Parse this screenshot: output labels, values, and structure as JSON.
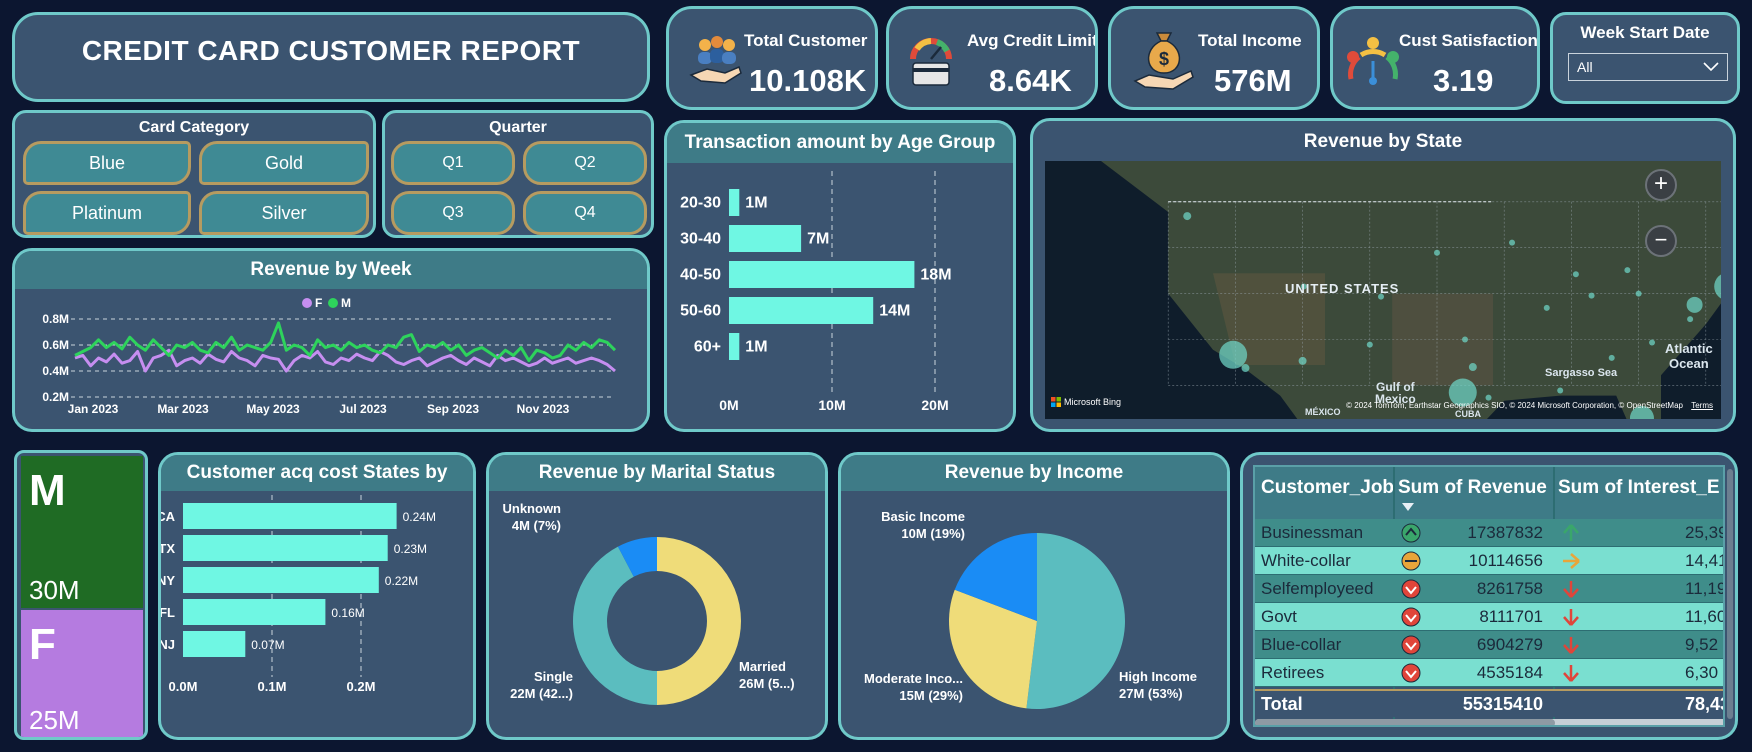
{
  "report_title": "CREDIT CARD CUSTOMER REPORT",
  "kpis": [
    {
      "title": "Total Customer",
      "value": "10.108K",
      "icon": "customers-hand-icon"
    },
    {
      "title": "Avg Credit Limit",
      "value": "8.64K",
      "icon": "credit-gauge-icon"
    },
    {
      "title": "Total Income",
      "value": "576M",
      "icon": "money-bag-hand-icon"
    },
    {
      "title": "Cust Satisfaction..",
      "value": "3.19",
      "icon": "satisfaction-meter-icon"
    }
  ],
  "week_filter": {
    "title": "Week Start Date",
    "selected": "All"
  },
  "card_category": {
    "title": "Card Category",
    "options": [
      "Blue",
      "Gold",
      "Platinum",
      "Silver"
    ]
  },
  "quarter": {
    "title": "Quarter",
    "options": [
      "Q1",
      "Q2",
      "Q3",
      "Q4"
    ]
  },
  "age_chart": {
    "title": "Transaction amount by Age Group"
  },
  "state_map": {
    "title": "Revenue by State",
    "labels": {
      "country": "UNITED STATES",
      "gulf": "Gulf of\nMexico",
      "atlantic": "Atlantic\nOcean",
      "sargasso": "Sargasso Sea",
      "mexico": "MÉXICO",
      "cuba": "CUBA"
    },
    "brand": "Microsoft Bing",
    "copyright": "© 2024 TomTom, Earthstar Geographics SIO, © 2024 Microsoft Corporation, © OpenStreetMap",
    "terms": "Terms",
    "zoom_in": "+",
    "zoom_out": "−"
  },
  "week_chart": {
    "title": "Revenue by Week"
  },
  "gender_tiles": [
    {
      "label": "M",
      "value": "30M",
      "color": "#1f6b24"
    },
    {
      "label": "F",
      "value": "25M",
      "color": "#b57be0"
    }
  ],
  "acq_chart": {
    "title": "Customer acq cost States by"
  },
  "marital_chart": {
    "title": "Revenue by Marital Status"
  },
  "income_chart": {
    "title": "Revenue by Income"
  },
  "job_table": {
    "columns": [
      "Customer_Job",
      "Sum of Revenue",
      "Sum of Interest_E"
    ],
    "rows": [
      {
        "job": "Businessman",
        "revenue": "17387832",
        "interest": "25,39",
        "status": "up",
        "trend": "up"
      },
      {
        "job": "White-collar",
        "revenue": "10114656",
        "interest": "14,41",
        "status": "mid",
        "trend": "right"
      },
      {
        "job": "Selfemployeed",
        "revenue": "8261758",
        "interest": "11,19",
        "status": "down",
        "trend": "down"
      },
      {
        "job": "Govt",
        "revenue": "8111701",
        "interest": "11,60",
        "status": "down",
        "trend": "down"
      },
      {
        "job": "Blue-collar",
        "revenue": "6904279",
        "interest": "9,52",
        "status": "down",
        "trend": "down"
      },
      {
        "job": "Retirees",
        "revenue": "4535184",
        "interest": "6,30",
        "status": "down",
        "trend": "down"
      }
    ],
    "total": {
      "label": "Total",
      "revenue": "55315410",
      "interest": "78,43"
    }
  },
  "chart_data": [
    {
      "type": "bar",
      "orientation": "horizontal",
      "title": "Transaction amount by Age Group",
      "categories": [
        "20-30",
        "30-40",
        "40-50",
        "50-60",
        "60+"
      ],
      "values": [
        1,
        7,
        18,
        14,
        1
      ],
      "data_labels": [
        "1M",
        "7M",
        "18M",
        "14M",
        "1M"
      ],
      "x_ticks": [
        "0M",
        "10M",
        "20M"
      ],
      "xlim": [
        0,
        20
      ],
      "unit": "M",
      "color": "#6ff7e3"
    },
    {
      "type": "line",
      "title": "Revenue by Week",
      "x_ticks": [
        "Jan 2023",
        "Mar 2023",
        "May 2023",
        "Jul 2023",
        "Sep 2023",
        "Nov 2023"
      ],
      "y_ticks": [
        "0.2M",
        "0.4M",
        "0.6M",
        "0.8M"
      ],
      "ylim": [
        0.2,
        0.8
      ],
      "legend_position": "top",
      "series": [
        {
          "name": "F",
          "color": "#c68ef0",
          "values": [
            0.5,
            0.52,
            0.44,
            0.5,
            0.47,
            0.53,
            0.46,
            0.48,
            0.55,
            0.4,
            0.5,
            0.52,
            0.56,
            0.44,
            0.48,
            0.5,
            0.46,
            0.53,
            0.49,
            0.47,
            0.55,
            0.5,
            0.48,
            0.44,
            0.52,
            0.5,
            0.49,
            0.4,
            0.48,
            0.52,
            0.5,
            0.55,
            0.47,
            0.45,
            0.5,
            0.48,
            0.53,
            0.5,
            0.48,
            0.55,
            0.52,
            0.47,
            0.45,
            0.48,
            0.5,
            0.44,
            0.47,
            0.5,
            0.52,
            0.48,
            0.45,
            0.5,
            0.47,
            0.44,
            0.52,
            0.48,
            0.5,
            0.47,
            0.44,
            0.46,
            0.5,
            0.46,
            0.48,
            0.5,
            0.46,
            0.48,
            0.5,
            0.48,
            0.45,
            0.4
          ]
        },
        {
          "name": "M",
          "color": "#2ed35c",
          "values": [
            0.52,
            0.55,
            0.58,
            0.64,
            0.58,
            0.62,
            0.57,
            0.66,
            0.6,
            0.56,
            0.64,
            0.58,
            0.52,
            0.6,
            0.58,
            0.62,
            0.56,
            0.54,
            0.62,
            0.58,
            0.66,
            0.56,
            0.6,
            0.58,
            0.56,
            0.62,
            0.77,
            0.56,
            0.6,
            0.58,
            0.52,
            0.64,
            0.58,
            0.6,
            0.56,
            0.62,
            0.58,
            0.6,
            0.56,
            0.54,
            0.6,
            0.58,
            0.66,
            0.68,
            0.55,
            0.6,
            0.58,
            0.62,
            0.56,
            0.6,
            0.52,
            0.56,
            0.58,
            0.54,
            0.5,
            0.56,
            0.52,
            0.58,
            0.48,
            0.56,
            0.54,
            0.5,
            0.52,
            0.6,
            0.56,
            0.62,
            0.58,
            0.64,
            0.62,
            0.56
          ]
        }
      ]
    },
    {
      "type": "bar",
      "orientation": "horizontal",
      "title": "Customer acq cost States by",
      "categories": [
        "CA",
        "TX",
        "NY",
        "FL",
        "NJ"
      ],
      "values": [
        0.24,
        0.23,
        0.22,
        0.16,
        0.07
      ],
      "data_labels": [
        "0.24M",
        "0.23M",
        "0.22M",
        "0.16M",
        "0.07M"
      ],
      "x_ticks": [
        "0.0M",
        "0.1M",
        "0.2M"
      ],
      "xlim": [
        0,
        0.3
      ],
      "unit": "M",
      "color": "#6ff7e3"
    },
    {
      "type": "pie",
      "donut": true,
      "title": "Revenue by Marital Status",
      "slices": [
        {
          "label": "Married",
          "value": 26,
          "text": "26M (5...)",
          "color": "#efdc79"
        },
        {
          "label": "Single",
          "value": 22,
          "text": "22M (42...)",
          "color": "#5bbdbf"
        },
        {
          "label": "Unknown",
          "value": 4,
          "text": "4M (7%)",
          "color": "#1a8cf5"
        }
      ]
    },
    {
      "type": "pie",
      "title": "Revenue by Income",
      "slices": [
        {
          "label": "High Income",
          "value": 27,
          "text": "27M (53%)",
          "color": "#5bbdbf"
        },
        {
          "label": "Moderate Inco...",
          "value": 15,
          "text": "15M (29%)",
          "color": "#efdc79"
        },
        {
          "label": "Basic Income",
          "value": 10,
          "text": "10M (19%)",
          "color": "#1a8cf5"
        }
      ]
    }
  ],
  "map_points": [
    {
      "name": "point",
      "lon": -122.3,
      "lat": 47.6,
      "size": 4
    },
    {
      "name": "point",
      "lon": -118.2,
      "lat": 34.0,
      "size": 14
    },
    {
      "name": "point",
      "lon": -117.1,
      "lat": 32.7,
      "size": 4
    },
    {
      "name": "point",
      "lon": -112.0,
      "lat": 33.4,
      "size": 4
    },
    {
      "name": "point",
      "lon": -111.9,
      "lat": 40.7,
      "size": 3
    },
    {
      "name": "point",
      "lon": -105.0,
      "lat": 39.7,
      "size": 3
    },
    {
      "name": "point",
      "lon": -97.7,
      "lat": 30.3,
      "size": 14
    },
    {
      "name": "point",
      "lon": -96.8,
      "lat": 32.8,
      "size": 4
    },
    {
      "name": "point",
      "lon": -95.4,
      "lat": 29.8,
      "size": 3
    },
    {
      "name": "point",
      "lon": -97.5,
      "lat": 35.5,
      "size": 3
    },
    {
      "name": "point",
      "lon": -93.3,
      "lat": 45.0,
      "size": 3
    },
    {
      "name": "point",
      "lon": -90.2,
      "lat": 38.6,
      "size": 3
    },
    {
      "name": "point",
      "lon": -87.6,
      "lat": 41.9,
      "size": 3
    },
    {
      "name": "point",
      "lon": -86.2,
      "lat": 39.8,
      "size": 3
    },
    {
      "name": "point",
      "lon": -84.4,
      "lat": 33.7,
      "size": 3
    },
    {
      "name": "point",
      "lon": -81.7,
      "lat": 27.8,
      "size": 12
    },
    {
      "name": "point",
      "lon": -80.8,
      "lat": 35.2,
      "size": 3
    },
    {
      "name": "point",
      "lon": -83.0,
      "lat": 42.3,
      "size": 3
    },
    {
      "name": "point",
      "lon": -82.0,
      "lat": 40.0,
      "size": 3
    },
    {
      "name": "point",
      "lon": -77.0,
      "lat": 38.9,
      "size": 8
    },
    {
      "name": "point",
      "lon": -74.0,
      "lat": 40.7,
      "size": 14
    },
    {
      "name": "point",
      "lon": -71.1,
      "lat": 42.4,
      "size": 4
    },
    {
      "name": "point",
      "lon": -77.4,
      "lat": 37.5,
      "size": 3
    },
    {
      "name": "point",
      "lon": -100.0,
      "lat": 44.0,
      "size": 3
    },
    {
      "name": "point",
      "lon": -106.0,
      "lat": 35.0,
      "size": 3
    },
    {
      "name": "point",
      "lon": -89.0,
      "lat": 30.5,
      "size": 3
    }
  ]
}
